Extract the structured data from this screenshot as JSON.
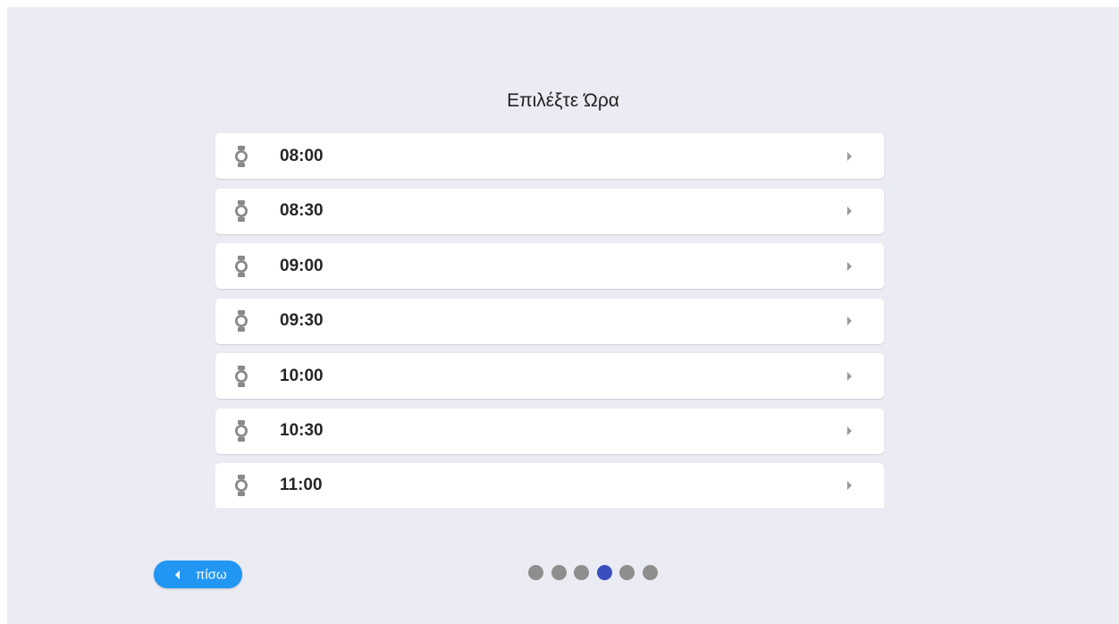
{
  "title": "Επιλέξτε Ώρα",
  "time_slots": [
    {
      "time": "08:00",
      "icon": "watch-icon"
    },
    {
      "time": "08:30",
      "icon": "watch-icon"
    },
    {
      "time": "09:00",
      "icon": "watch-icon"
    },
    {
      "time": "09:30",
      "icon": "watch-icon"
    },
    {
      "time": "10:00",
      "icon": "watch-icon"
    },
    {
      "time": "10:30",
      "icon": "watch-icon"
    },
    {
      "time": "11:00",
      "icon": "watch-icon"
    }
  ],
  "back_button": {
    "label": "πίσω",
    "icon": "chevron-left-icon"
  },
  "stepper": {
    "total_steps": 6,
    "active_step": 4
  },
  "colors": {
    "background": "#ebebf4",
    "card": "#ffffff",
    "back_button": "#2196f3",
    "dot_inactive": "#8e8e8e",
    "dot_active": "#3a4fbd",
    "icon": "#8a8a8a"
  }
}
